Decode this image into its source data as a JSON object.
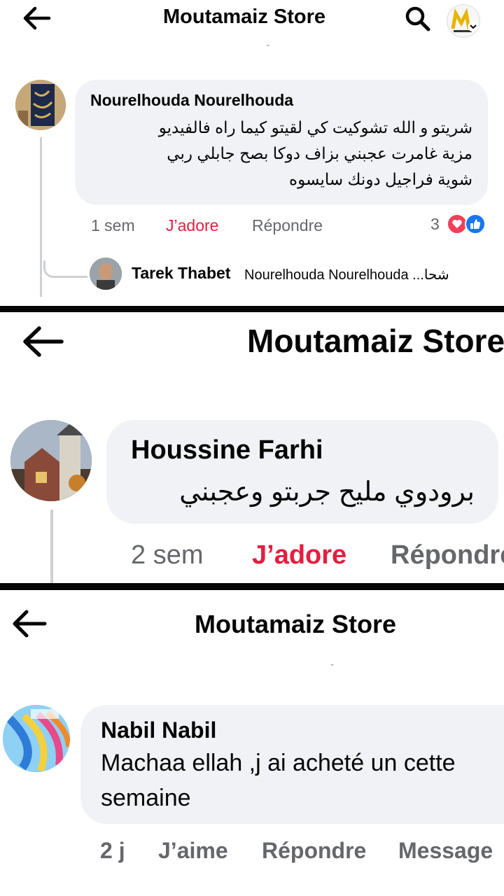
{
  "colors": {
    "like": "#e41e3f",
    "meta": "#65676b",
    "bubble": "#f0f2f5",
    "love": "#f33e58",
    "like_blue": "#1877f2"
  },
  "panel1": {
    "header_title": "Moutamaiz Store",
    "header_dot": "-",
    "comment": {
      "author": "Nourelhouda Nourelhouda",
      "text_lines": [
        "شريتو و الله تشوكيت كي لقيتو كيما راه فالفيديو",
        "مزية غامرت عجبني بزاف دوكا بصح جابلي ربي",
        "شوية فراجيل دونك سايسوه"
      ],
      "time": "1 sem",
      "like": "J’adore",
      "reply": "Répondre",
      "reaction_count": "3"
    },
    "reply_preview": {
      "author": "Tarek Thabet",
      "text": "Nourelhouda Nourelhouda ...شحا"
    }
  },
  "panel2": {
    "header_title": "Moutamaiz Store",
    "comment": {
      "author": "Houssine Farhi",
      "text": "برودوي مليح جربتو وعجبني",
      "time": "2 sem",
      "like": "J’adore",
      "reply": "Répondre"
    }
  },
  "panel3": {
    "header_title": "Moutamaiz Store",
    "header_dot": "-",
    "comment": {
      "author": "Nabil Nabil",
      "text_lines": [
        "Machaa ellah ,j ai acheté un cette",
        "semaine"
      ],
      "time": "2 j",
      "like": "J’aime",
      "reply": "Répondre",
      "message": "Message"
    }
  }
}
